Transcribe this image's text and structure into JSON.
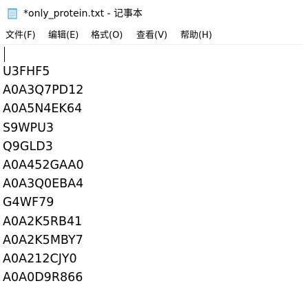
{
  "window": {
    "title": "*only_protein.txt - 记事本",
    "icon": "notepad-icon"
  },
  "menu": {
    "items": [
      {
        "label": "文件(F)"
      },
      {
        "label": "编辑(E)"
      },
      {
        "label": "格式(O)"
      },
      {
        "label": "查看(V)"
      },
      {
        "label": "帮助(H)"
      }
    ]
  },
  "editor": {
    "first_line": "",
    "lines": [
      "U3FHF5",
      "A0A3Q7PD12",
      "A0A5N4EK64",
      "S9WPU3",
      "Q9GLD3",
      "A0A452GAA0",
      "A0A3Q0EBA4",
      "G4WF79",
      "A0A2K5RB41",
      "A0A2K5MBY7",
      "A0A212CJY0",
      "A0A0D9R866"
    ]
  }
}
